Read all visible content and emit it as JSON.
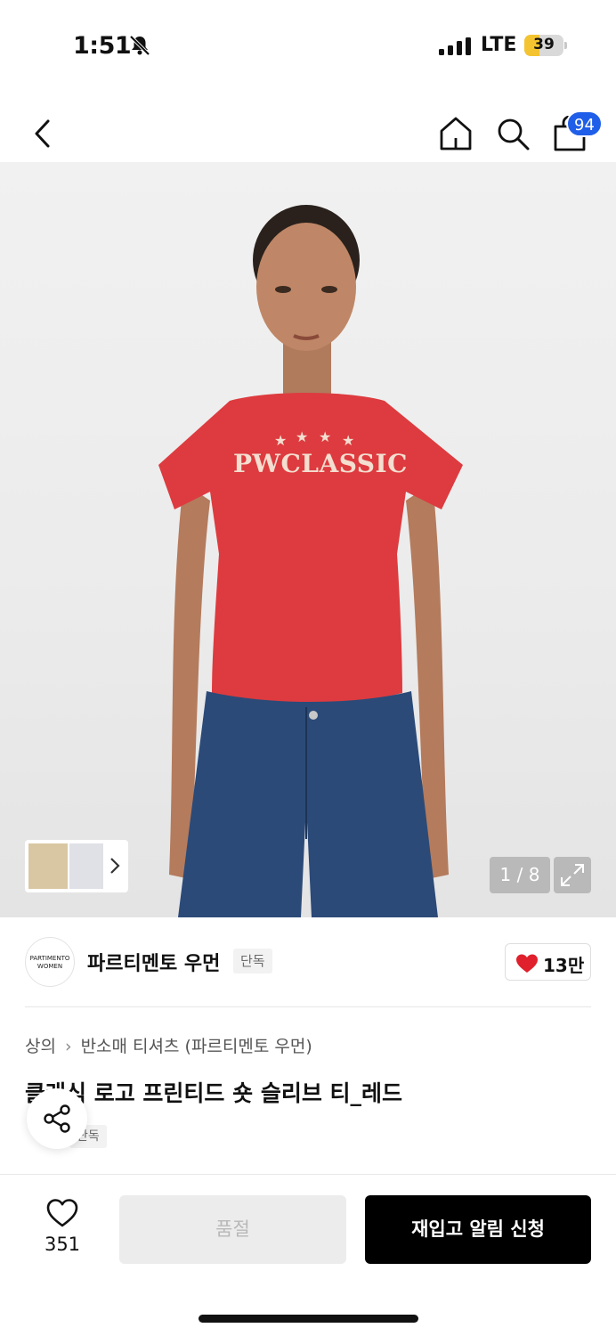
{
  "status_bar": {
    "time": "1:51",
    "network": "LTE",
    "battery": "39",
    "battery_level": 0.39
  },
  "nav": {
    "cart_count": "94"
  },
  "gallery": {
    "page_counter": "1 / 8",
    "shirt_print_text": "PWCLASSIC"
  },
  "brand": {
    "logo_text_line1": "PARTIMENTO",
    "logo_text_line2": "WOMEN",
    "name": "파르티멘토 우먼",
    "badge": "단독",
    "likes": "13만"
  },
  "product": {
    "breadcrumb": [
      "상의",
      "반소매 티셔츠 (파르티멘토 우먼)"
    ],
    "title": "클래식 로고 프린티드 숏 슬리브 티_레드",
    "tag": "단독"
  },
  "bottom_bar": {
    "wish_count": "351",
    "soldout_label": "품절",
    "restock_label": "재입고 알림 신청"
  },
  "colors": {
    "accent_blue": "#1f5ee8",
    "heart_red": "#e0202c",
    "shirt_red": "#dd3b3f",
    "denim": "#2b4a78"
  }
}
